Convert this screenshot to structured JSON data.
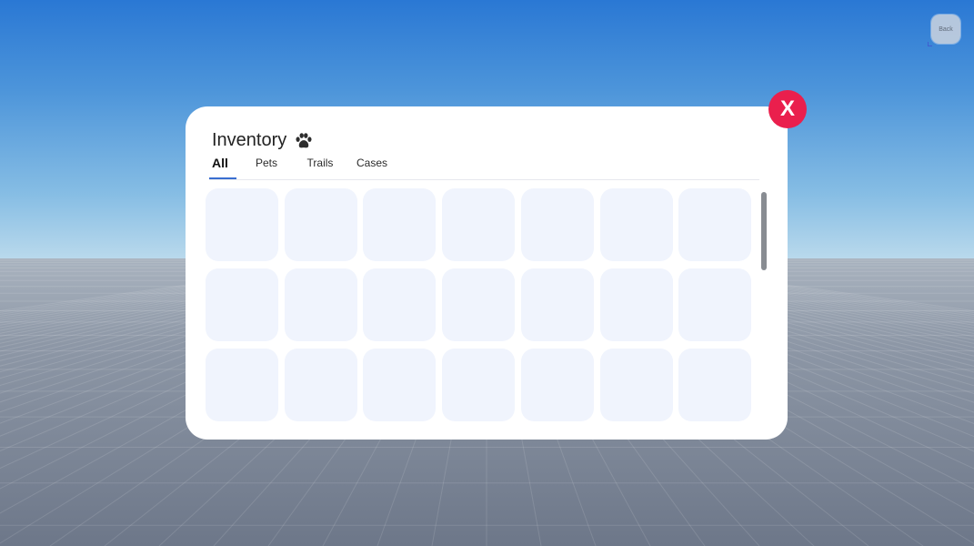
{
  "back_button": {
    "label": "Back"
  },
  "close_button": {
    "label": "X"
  },
  "inventory": {
    "title": "Inventory",
    "title_icon": "paw-icon",
    "tabs": [
      {
        "label": "All",
        "active": true
      },
      {
        "label": "Pets",
        "active": false
      },
      {
        "label": "Trails",
        "active": false
      },
      {
        "label": "Cases",
        "active": false
      }
    ],
    "visible_slot_rows": 3,
    "slots_per_row": 7
  },
  "colors": {
    "panel": "#ffffff",
    "slot": "#f0f4fd",
    "close": "#ea1f4d",
    "tab_accent": "#3a6fd0"
  }
}
